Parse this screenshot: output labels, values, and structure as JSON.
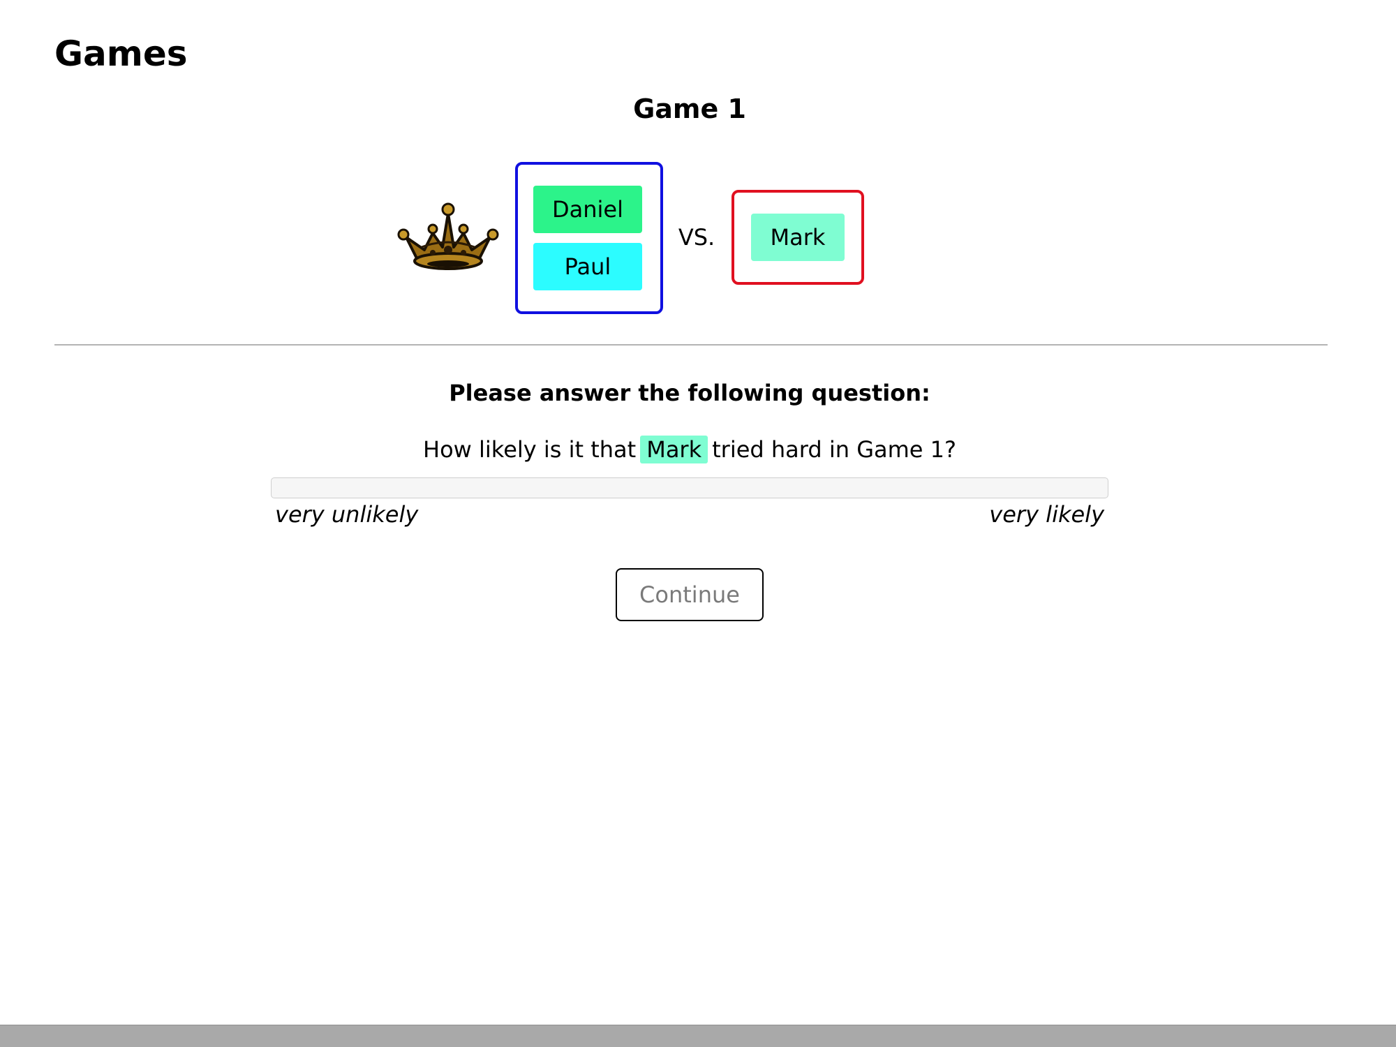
{
  "page": {
    "title": "Games"
  },
  "game": {
    "title": "Game 1",
    "vs_label": "VS.",
    "winner_icon": "crown-icon",
    "winning_team": {
      "border_color": "#1010e0",
      "players": [
        {
          "name": "Daniel",
          "color": "#2cf38a"
        },
        {
          "name": "Paul",
          "color": "#2cfcff"
        }
      ]
    },
    "losing_team": {
      "border_color": "#e01020",
      "players": [
        {
          "name": "Mark",
          "color": "#7ffdd2"
        }
      ]
    }
  },
  "question": {
    "heading": "Please answer the following question:",
    "text_before": "How likely is it that",
    "highlighted_name": "Mark",
    "highlight_color": "#7ffdd2",
    "text_after": "tried hard in Game 1?",
    "scale_min_label": "very unlikely",
    "scale_max_label": "very likely"
  },
  "actions": {
    "continue_label": "Continue"
  }
}
